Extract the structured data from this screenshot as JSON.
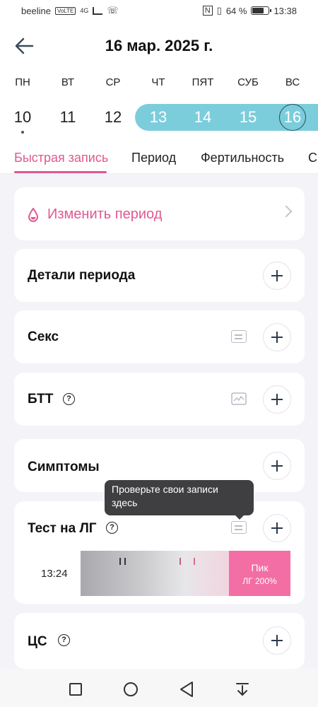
{
  "status_bar": {
    "carrier": "beeline",
    "volte": "VoLTE",
    "network": "4G",
    "battery": "64 %",
    "battery_fraction": 0.64,
    "time": "13:38"
  },
  "header": {
    "title": "16 мар. 2025 г."
  },
  "week": {
    "days": [
      "ПН",
      "ВТ",
      "СР",
      "ЧТ",
      "ПЯТ",
      "СУБ",
      "ВС"
    ],
    "dates": [
      {
        "num": "10",
        "dot": true,
        "period": false
      },
      {
        "num": "11",
        "dot": false,
        "period": false
      },
      {
        "num": "12",
        "dot": false,
        "period": false
      },
      {
        "num": "13",
        "dot": true,
        "period": true
      },
      {
        "num": "14",
        "dot": true,
        "period": true
      },
      {
        "num": "15",
        "dot": true,
        "period": true
      },
      {
        "num": "16",
        "dot": true,
        "period": true,
        "selected": true
      }
    ]
  },
  "tabs": [
    "Быстрая запись",
    "Период",
    "Фертильность",
    "Сп"
  ],
  "cards": {
    "change_period": "Изменить период",
    "period_details": "Детали периода",
    "sex": "Секс",
    "btt": "БТТ",
    "symptoms": "Симптомы",
    "lh_test": "Тест на ЛГ",
    "cs": "ЦС"
  },
  "lh_entry": {
    "time": "13:24",
    "result_line1": "Пик",
    "result_line2": "ЛГ 200%"
  },
  "tooltip": {
    "text": "Проверьте свои записи здесь"
  },
  "colors": {
    "accent": "#e0598f",
    "period_band": "#7ccddc",
    "lh_peak": "#f36ea4"
  }
}
